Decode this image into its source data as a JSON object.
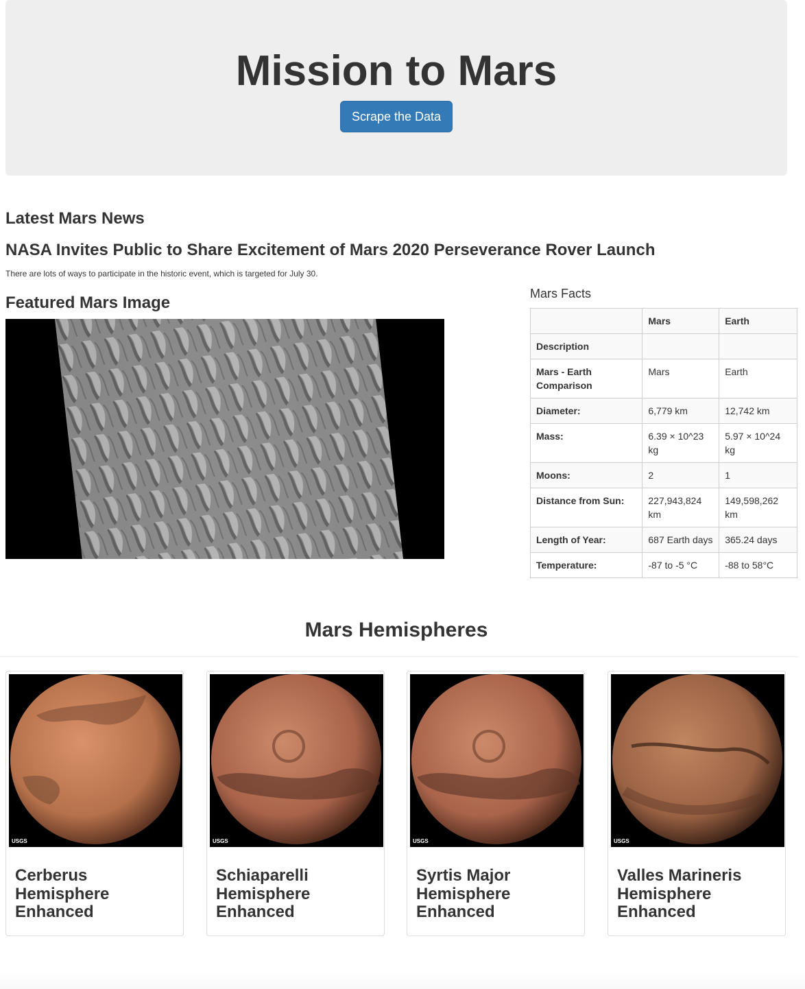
{
  "header": {
    "title": "Mission to Mars",
    "scrape_button": "Scrape the Data"
  },
  "news": {
    "heading": "Latest Mars News",
    "title": "NASA Invites Public to Share Excitement of Mars 2020 Perseverance Rover Launch",
    "teaser": "There are lots of ways to participate in the historic event, which is targeted for July 30."
  },
  "featured": {
    "heading": "Featured Mars Image"
  },
  "facts": {
    "heading": "Mars Facts",
    "columns": [
      "",
      "Mars",
      "Earth"
    ],
    "rows": [
      {
        "label": "Description",
        "mars": "",
        "earth": ""
      },
      {
        "label": "Mars - Earth Comparison",
        "mars": "Mars",
        "earth": "Earth"
      },
      {
        "label": "Diameter:",
        "mars": "6,779 km",
        "earth": "12,742 km"
      },
      {
        "label": "Mass:",
        "mars": "6.39 × 10^23 kg",
        "earth": "5.97 × 10^24 kg"
      },
      {
        "label": "Moons:",
        "mars": "2",
        "earth": "1"
      },
      {
        "label": "Distance from Sun:",
        "mars": "227,943,824 km",
        "earth": "149,598,262 km"
      },
      {
        "label": "Length of Year:",
        "mars": "687 Earth days",
        "earth": "365.24 days"
      },
      {
        "label": "Temperature:",
        "mars": "-87 to -5 °C",
        "earth": "-88 to 58°C"
      }
    ]
  },
  "hemispheres": {
    "heading": "Mars Hemispheres",
    "items": [
      {
        "title": "Cerberus Hemisphere Enhanced",
        "watermark": "USGS",
        "color": "#b5714b"
      },
      {
        "title": "Schiaparelli Hemisphere Enhanced",
        "watermark": "USGS",
        "color": "#a8634a"
      },
      {
        "title": "Syrtis Major Hemisphere Enhanced",
        "watermark": "USGS",
        "color": "#a8634a"
      },
      {
        "title": "Valles Marineris Hemisphere Enhanced",
        "watermark": "USGS",
        "color": "#9a6244"
      }
    ]
  },
  "colors": {
    "jumbotron_bg": "#eeeeee",
    "button_bg": "#337ab7",
    "text": "#333333"
  }
}
